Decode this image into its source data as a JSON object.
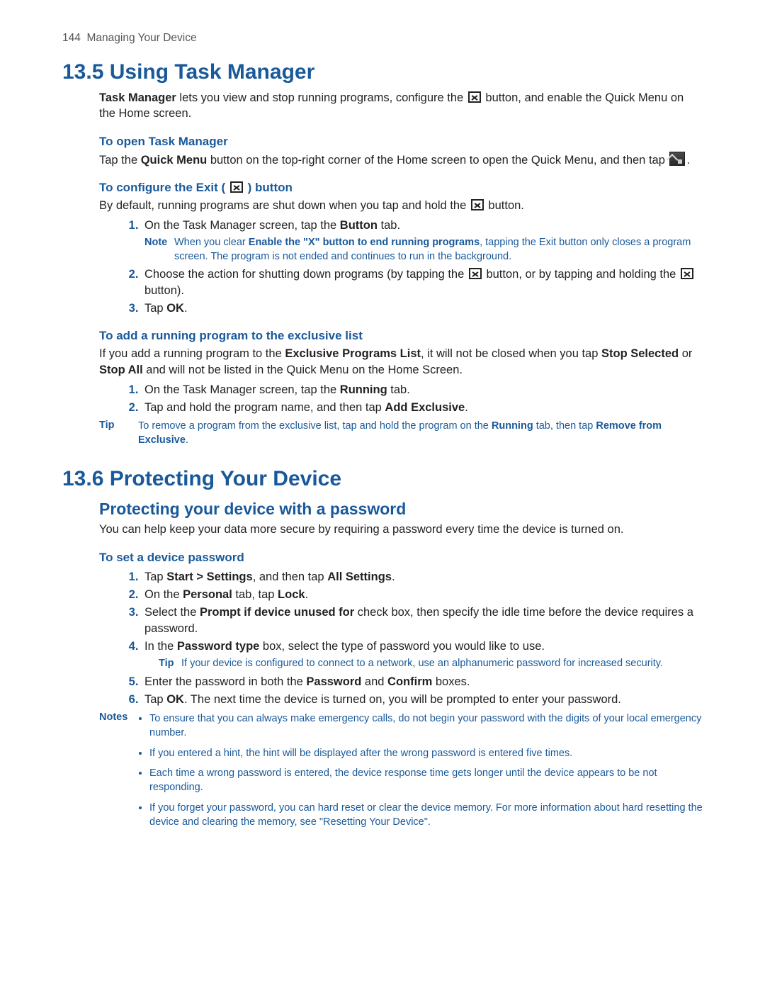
{
  "header": {
    "page_num": "144",
    "chapter": "Managing Your Device"
  },
  "s135": {
    "title": "13.5  Using Task Manager",
    "intro_a": "Task Manager",
    "intro_b": " lets you view and stop running programs, configure the ",
    "intro_c": " button, and enable the Quick Menu on the Home screen.",
    "h_open": "To open Task Manager",
    "open_a": "Tap the ",
    "open_b": "Quick Menu",
    "open_c": " button on the top-right corner of the Home screen to open the Quick Menu, and then tap ",
    "open_d": ".",
    "h_conf_a": "To configure the Exit ( ",
    "h_conf_b": " ) button",
    "conf_intro_a": "By default, running programs are shut down when you tap and hold the ",
    "conf_intro_b": " button.",
    "conf_s1_a": "On the Task Manager screen, tap the ",
    "conf_s1_b": "Button",
    "conf_s1_c": " tab.",
    "conf_note_lbl": "Note",
    "conf_note_a": "When you clear ",
    "conf_note_b": "Enable the \"X\" button to end running programs",
    "conf_note_c": ", tapping the Exit button only closes a program screen. The program is not ended and continues to run in the background.",
    "conf_s2_a": "Choose the action for shutting down programs (by tapping the ",
    "conf_s2_b": " button, or by tapping and holding the ",
    "conf_s2_c": " button).",
    "conf_s3_a": "Tap ",
    "conf_s3_b": "OK",
    "conf_s3_c": ".",
    "h_excl": "To add a running program to the exclusive list",
    "excl_intro_a": "If you add a running program to the ",
    "excl_intro_b": "Exclusive Programs List",
    "excl_intro_c": ", it will not be closed when you tap ",
    "excl_intro_d": "Stop Selected",
    "excl_intro_e": " or ",
    "excl_intro_f": "Stop All",
    "excl_intro_g": " and will not be listed in the Quick Menu on the Home Screen.",
    "excl_s1_a": "On the Task Manager screen, tap the ",
    "excl_s1_b": "Running",
    "excl_s1_c": " tab.",
    "excl_s2_a": "Tap and hold the program name, and then tap ",
    "excl_s2_b": "Add Exclusive",
    "excl_s2_c": ".",
    "excl_tip_lbl": "Tip",
    "excl_tip_a": "To remove a program from the exclusive list, tap and hold the program on the ",
    "excl_tip_b": "Running",
    "excl_tip_c": " tab, then tap ",
    "excl_tip_d": "Remove from Exclusive",
    "excl_tip_e": "."
  },
  "s136": {
    "title": "13.6  Protecting Your Device",
    "h2": "Protecting your device with a password",
    "intro": "You can help keep your data more secure by requiring a password every time the device is turned on.",
    "h_set": "To set a device password",
    "s1_a": "Tap ",
    "s1_b": "Start > Settings",
    "s1_c": ", and then tap ",
    "s1_d": "All Settings",
    "s1_e": ".",
    "s2_a": "On the ",
    "s2_b": "Personal",
    "s2_c": " tab, tap ",
    "s2_d": "Lock",
    "s2_e": ".",
    "s3_a": "Select the ",
    "s3_b": "Prompt if device unused for",
    "s3_c": " check box, then specify the idle time before the device requires a password.",
    "s4_a": "In the ",
    "s4_b": "Password type",
    "s4_c": " box, select the type of password you would like to use.",
    "s4_tip_lbl": "Tip",
    "s4_tip": "If your device is configured to connect to a network, use an alphanumeric password for increased security.",
    "s5_a": "Enter the password in both the ",
    "s5_b": "Password",
    "s5_c": " and ",
    "s5_d": "Confirm",
    "s5_e": " boxes.",
    "s6_a": "Tap ",
    "s6_b": "OK",
    "s6_c": ". The next time the device is turned on, you will be prompted to enter your password.",
    "notes_lbl": "Notes",
    "note1": "To ensure that you can always make emergency calls, do not begin your password with the digits of your local emergency number.",
    "note2": "If you entered a hint, the hint will be displayed after the wrong password is entered five times.",
    "note3": "Each time a wrong password is entered, the device response time gets longer until the device appears to be not responding.",
    "note4": "If you forget your password, you can hard reset or clear the device memory. For more information about hard resetting the device and clearing the memory, see \"Resetting Your Device\"."
  }
}
